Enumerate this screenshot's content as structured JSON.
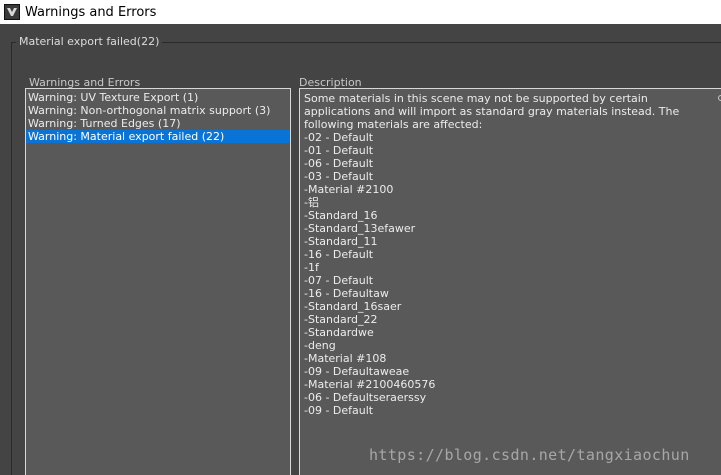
{
  "window": {
    "title": "Warnings and Errors"
  },
  "group": {
    "legend": "Material export failed(22)"
  },
  "left_panel": {
    "label": "Warnings and Errors",
    "items": [
      {
        "label": "Warning: UV Texture Export (1)"
      },
      {
        "label": "Warning: Non-orthogonal matrix support (3)"
      },
      {
        "label": "Warning: Turned Edges (17)"
      },
      {
        "label": "Warning: Material export failed (22)",
        "selected": true
      }
    ]
  },
  "right_panel": {
    "label": "Description",
    "intro": "Some materials in this scene may not be supported by certain applications and will import as standard gray materials instead. The following materials are affected:",
    "materials": [
      " -02 - Default",
      " -01 - Default",
      " -06 - Default",
      " -03 - Default",
      " -Material #2100",
      " -铝",
      " -Standard_16",
      " -Standard_13efawer",
      " -Standard_11",
      " -16 - Default",
      " -1f",
      " -07 - Default",
      " -16 - Defaultaw",
      " -Standard_16saer",
      " -Standard_22",
      " -Standardwe",
      " -deng",
      " -Material #108",
      " -09 - Defaultaweae",
      " -Material #2100460576",
      " -06 - Defaultseraerssy",
      " -09 - Default"
    ]
  },
  "watermark": "https://blog.csdn.net/tangxiaochun",
  "colors": {
    "background": "#444444",
    "panel": "#595959",
    "selection": "#0a74d6"
  }
}
